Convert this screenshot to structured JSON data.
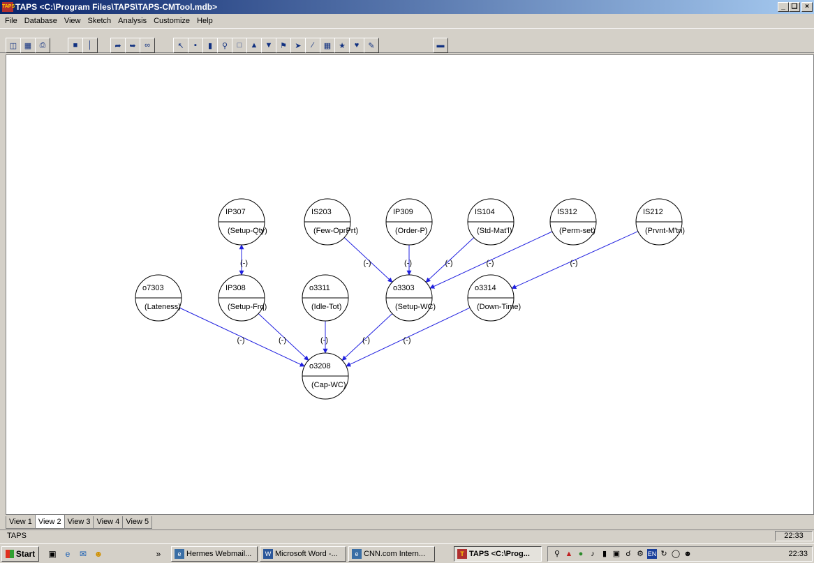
{
  "window": {
    "app_icon": "TAPS",
    "title": "TAPS <C:\\Program Files\\TAPS\\TAPS-CMTool.mdb>",
    "minimize": "_",
    "maximize": "❑",
    "close": "×"
  },
  "menu": [
    "File",
    "Database",
    "View",
    "Sketch",
    "Analysis",
    "Customize",
    "Help"
  ],
  "toolbar_icons": [
    "open-icon",
    "save-icon",
    "print-icon",
    "gray-box-icon",
    "bar-icon",
    "redo-icon",
    "undo-icon",
    "link-icon",
    "select-icon",
    "connect-icon",
    "bars-icon",
    "zoom-icon",
    "rectangle-icon",
    "triangle-up-icon",
    "triangle-down-icon",
    "flag-icon",
    "arrow-icon",
    "line-icon",
    "grid-icon",
    "star-icon",
    "heart-icon",
    "note-icon",
    "ruler-icon"
  ],
  "diagram": {
    "nodes": [
      {
        "id": "IP307",
        "label": "(Setup-Qty)"
      },
      {
        "id": "IS203",
        "label": "(Few-OprPrt)"
      },
      {
        "id": "IP309",
        "label": "(Order-P)"
      },
      {
        "id": "IS104",
        "label": "(Std-Mat'l)"
      },
      {
        "id": "IS312",
        "label": "(Perm-set)"
      },
      {
        "id": "IS212",
        "label": "(Prvnt-M'tn)"
      },
      {
        "id": "o7303",
        "label": "(Lateness)"
      },
      {
        "id": "IP308",
        "label": "(Setup-Frq)"
      },
      {
        "id": "o3311",
        "label": "(Idle-Tot)"
      },
      {
        "id": "o3303",
        "label": "(Setup-WC)"
      },
      {
        "id": "o3314",
        "label": "(Down-Time)"
      },
      {
        "id": "o3208",
        "label": "(Cap-WC)"
      }
    ],
    "edges": [
      {
        "from": "IP307",
        "to": "IP308",
        "sign": "(-)",
        "bidirectional": true
      },
      {
        "from": "IS203",
        "to": "o3303",
        "sign": "(-)"
      },
      {
        "from": "IP309",
        "to": "o3303",
        "sign": "(-)"
      },
      {
        "from": "IS104",
        "to": "o3303",
        "sign": "(-)"
      },
      {
        "from": "IS312",
        "to": "o3303",
        "sign": "(-)"
      },
      {
        "from": "IS212",
        "to": "o3314",
        "sign": "(-)"
      },
      {
        "from": "o7303",
        "to": "o3208",
        "sign": "(-)"
      },
      {
        "from": "IP308",
        "to": "o3208",
        "sign": "(-)"
      },
      {
        "from": "o3311",
        "to": "o3208",
        "sign": "(-)"
      },
      {
        "from": "o3303",
        "to": "o3208",
        "sign": "(-)"
      },
      {
        "from": "o3314",
        "to": "o3208",
        "sign": "(-)"
      }
    ],
    "edge_color": "#2020e0"
  },
  "tabs": {
    "items": [
      "View 1",
      "View 2",
      "View 3",
      "View 4",
      "View 5"
    ],
    "active": "View 2"
  },
  "status": {
    "text": "TAPS",
    "time": "22:33"
  },
  "taskbar": {
    "start": "Start",
    "quicklaunch": [
      "desktop-icon",
      "ie-icon",
      "outlook-icon",
      "messenger-icon"
    ],
    "chevron": "»",
    "tasks": [
      {
        "label": "Hermes Webmail...",
        "icon": "ie-icon"
      },
      {
        "label": "Microsoft Word -...",
        "icon": "word-icon"
      },
      {
        "label": "CNN.com Intern...",
        "icon": "ie-icon"
      },
      {
        "label": "TAPS <C:\\Prog...",
        "icon": "taps-icon",
        "active": true
      }
    ],
    "tray_lang": "EN",
    "clock": "22:33"
  }
}
